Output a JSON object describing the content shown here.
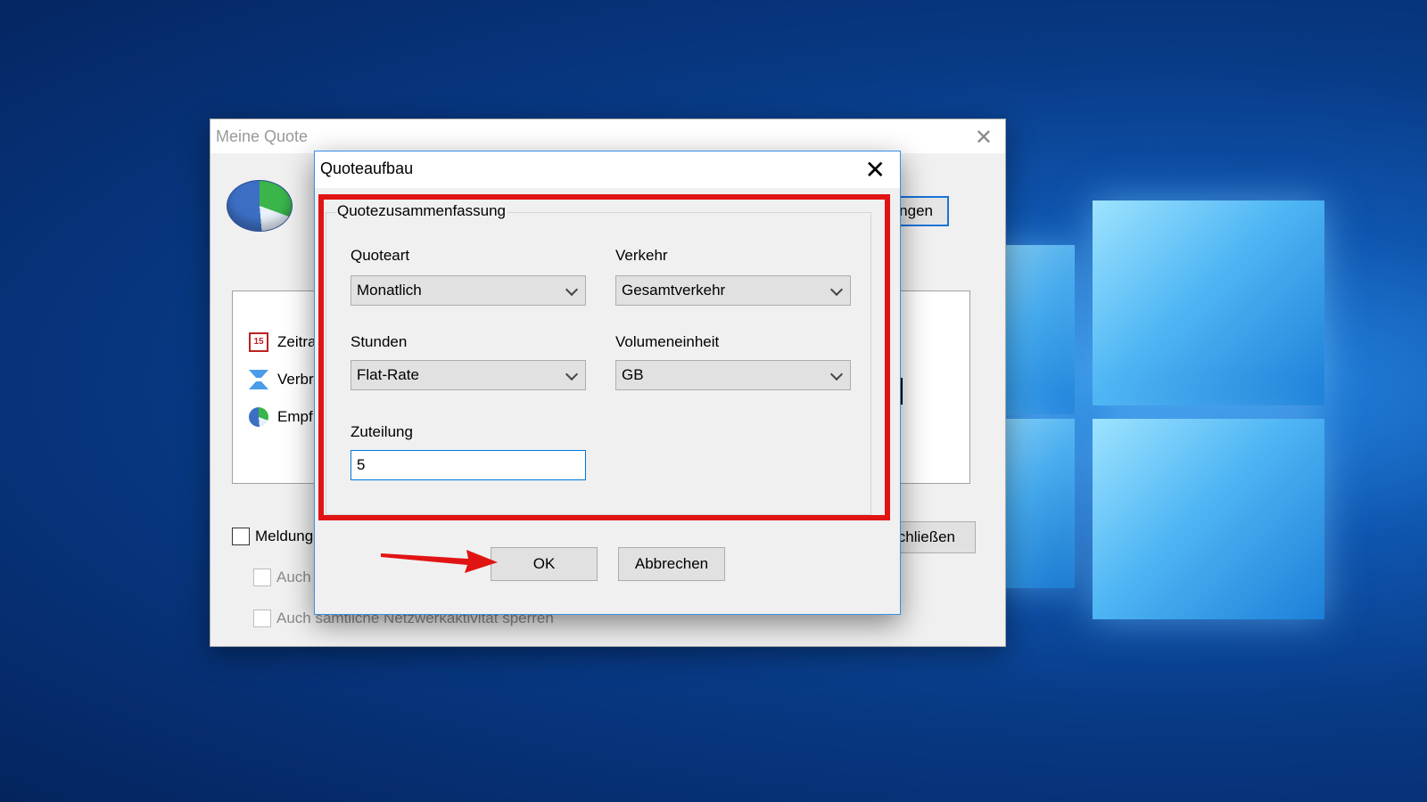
{
  "background_window": {
    "title": "Meine Quote",
    "settings_button_label": "ungen",
    "list_items": [
      "Zeitra",
      "Verbr",
      "Empf"
    ],
    "calendar_icon_number": "15",
    "close_button_label": "chließen",
    "checkbox_1_label": "Meldung",
    "checkbox_2_label": "Auch",
    "checkbox_3_label": "Auch sämtliche Netzwerkaktivität sperren"
  },
  "dialog": {
    "title": "Quoteaufbau",
    "group_title": "Quotezusammenfassung",
    "quota_type": {
      "label": "Quoteart",
      "value": "Monatlich"
    },
    "traffic": {
      "label": "Verkehr",
      "value": "Gesamtverkehr"
    },
    "hours": {
      "label": "Stunden",
      "value": "Flat-Rate"
    },
    "volume_unit": {
      "label": "Volumeneinheit",
      "value": "GB"
    },
    "allocation": {
      "label": "Zuteilung",
      "value": "5"
    },
    "ok_label": "OK",
    "cancel_label": "Abbrechen"
  },
  "colors": {
    "highlight": "#e11414",
    "arrow": "#e11414",
    "focus_border": "#0078d7"
  },
  "icons": {
    "close": "close-icon",
    "dropdown": "chevron-down-icon",
    "app_logo": "pie-chart-icon"
  }
}
